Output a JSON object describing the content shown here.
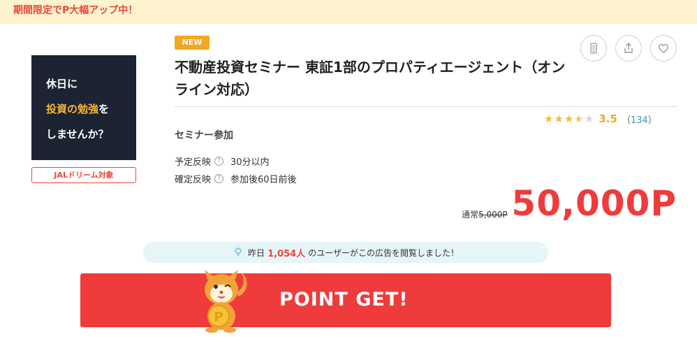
{
  "banner": {
    "text": "期間限定でP大幅アップ中！"
  },
  "thumbnail": {
    "line1": "休日に",
    "line2_highlight": "投資の勉強",
    "line2_rest": "を",
    "line3": "しませんか？"
  },
  "jal_badge": "JALドリーム対象",
  "new_badge": "NEW",
  "title": "不動産投資セミナー 東証1部のプロパティエージェント（オンライン対応）",
  "actions": {
    "device": "mobile-icon",
    "share": "share-icon",
    "favorite": "heart-icon"
  },
  "rating": {
    "stars": 3.5,
    "value": "3.5",
    "count": "134",
    "open": "（",
    "close": "）"
  },
  "category": "セミナー参加",
  "schedule": {
    "planned_label": "予定反映",
    "planned_value": "30分以内",
    "confirmed_label": "確定反映",
    "confirmed_value": "参加後60日前後",
    "help_icon": "?"
  },
  "points": {
    "normal_label": "通常",
    "normal_value": "5,000P",
    "value": "50,000P"
  },
  "notice": {
    "prefix": "昨日",
    "count": "1,054人",
    "suffix": "のユーザーがこの広告を閲覧しました！"
  },
  "cta": {
    "label": "POINT GET!"
  },
  "colors": {
    "accent": "#ef3b3b",
    "banner_bg": "#fdf3cf",
    "star": "#f5b83d"
  }
}
